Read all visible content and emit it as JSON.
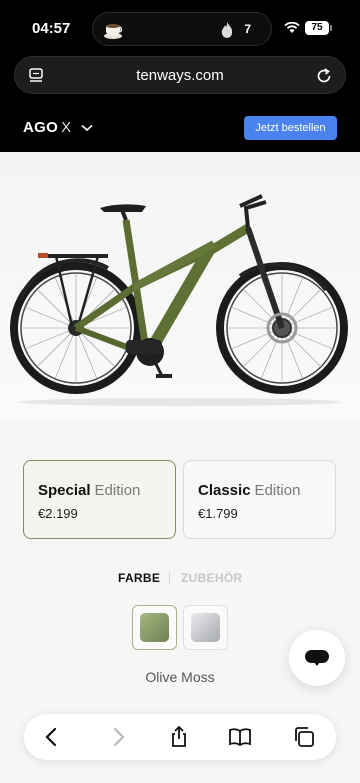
{
  "status_bar": {
    "time": "04:57",
    "activity_count": "7",
    "battery": "75",
    "icons": [
      "coffee-cup-icon",
      "flame-icon",
      "wifi-icon",
      "battery-icon"
    ]
  },
  "browser": {
    "url": "tenways.com",
    "icons": [
      "reader-mode-icon",
      "reload-icon"
    ]
  },
  "site_header": {
    "model_name": "AGO",
    "model_suffix": "X",
    "order_button": "Jetzt bestellen",
    "accent_color": "#4a83f0"
  },
  "editions": [
    {
      "name": "Special",
      "suffix": "Edition",
      "price": "€2.199",
      "selected": true
    },
    {
      "name": "Classic",
      "suffix": "Edition",
      "price": "€1.799",
      "selected": false
    }
  ],
  "tabs": {
    "active": "FARBE",
    "inactive": "ZUBEHÖR"
  },
  "colors": {
    "options": [
      {
        "name": "Olive Moss",
        "selected": true,
        "swatch": "#8fa06a"
      },
      {
        "name": "",
        "selected": false,
        "swatch": "#c8cacd"
      }
    ],
    "selected_name": "Olive Moss"
  },
  "toolbar": {
    "icons": [
      "back-icon",
      "forward-icon",
      "share-icon",
      "bookmarks-icon",
      "tabs-icon"
    ]
  }
}
